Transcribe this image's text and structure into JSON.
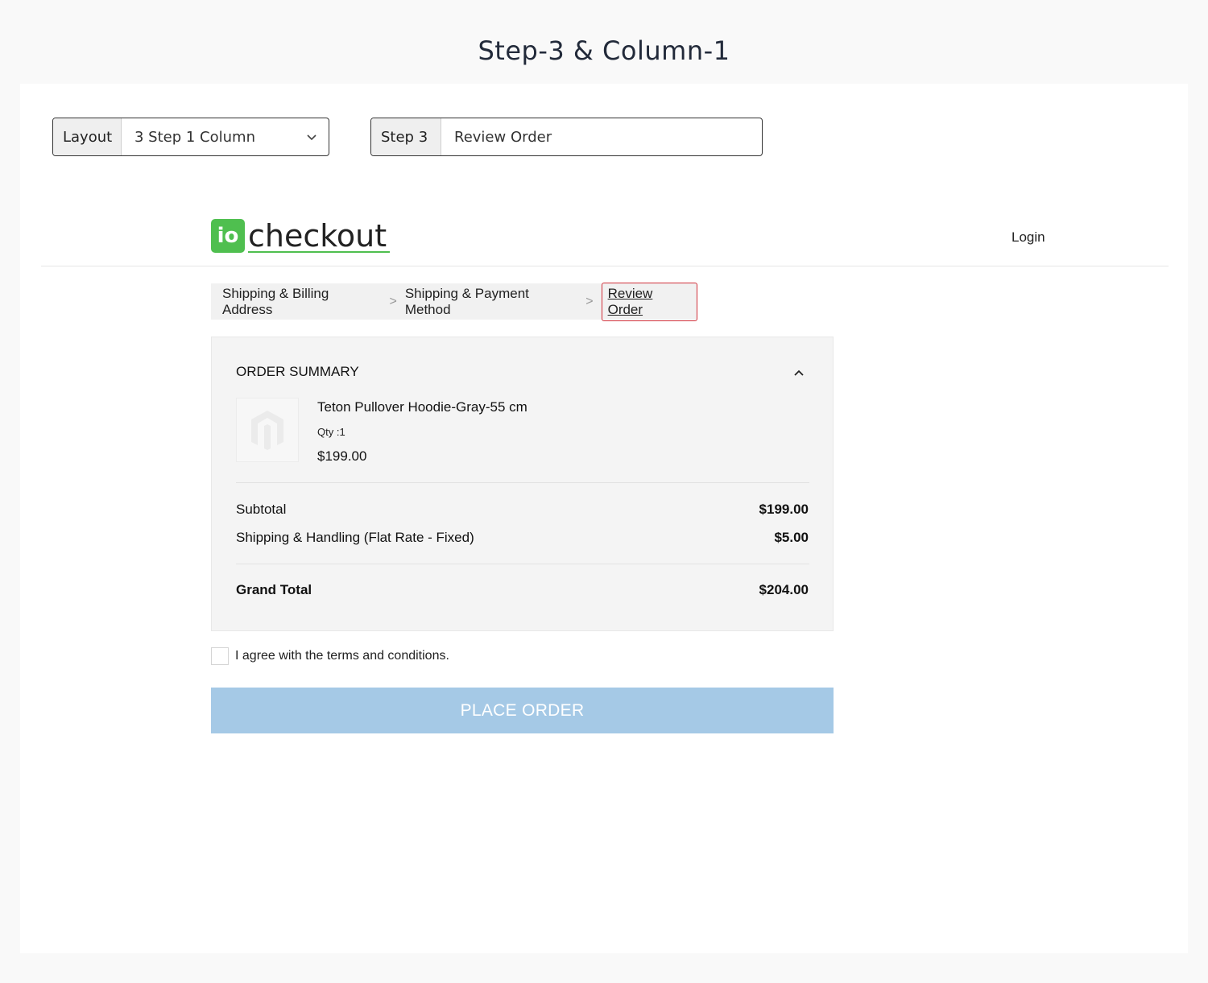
{
  "page": {
    "heading": "Step-3 & Column-1"
  },
  "controls": {
    "layout_label": "Layout",
    "layout_value": "3 Step 1 Column",
    "step_label": "Step 3",
    "step_value": "Review Order"
  },
  "header": {
    "logo_badge": "io",
    "logo_text": "checkout",
    "login": "Login"
  },
  "breadcrumb": {
    "items": [
      "Shipping & Billing Address",
      "Shipping & Payment Method"
    ],
    "separator": ">",
    "current": "Review Order"
  },
  "summary": {
    "title": "ORDER SUMMARY",
    "product": {
      "name": "Teton Pullover Hoodie-Gray-55 cm",
      "qty": "Qty :1",
      "price": "$199.00"
    },
    "subtotal_label": "Subtotal",
    "subtotal_value": "$199.00",
    "shipping_label": "Shipping & Handling (Flat Rate - Fixed)",
    "shipping_value": "$5.00",
    "grand_total_label": "Grand Total",
    "grand_total_value": "$204.00"
  },
  "terms": {
    "label": "I agree with the terms and conditions.",
    "checked": false
  },
  "place_order": {
    "label": "PLACE ORDER",
    "color": "#a5c9e6"
  },
  "colors": {
    "brand_green": "#4fbf4f",
    "current_crumb_border": "#d0303a"
  }
}
